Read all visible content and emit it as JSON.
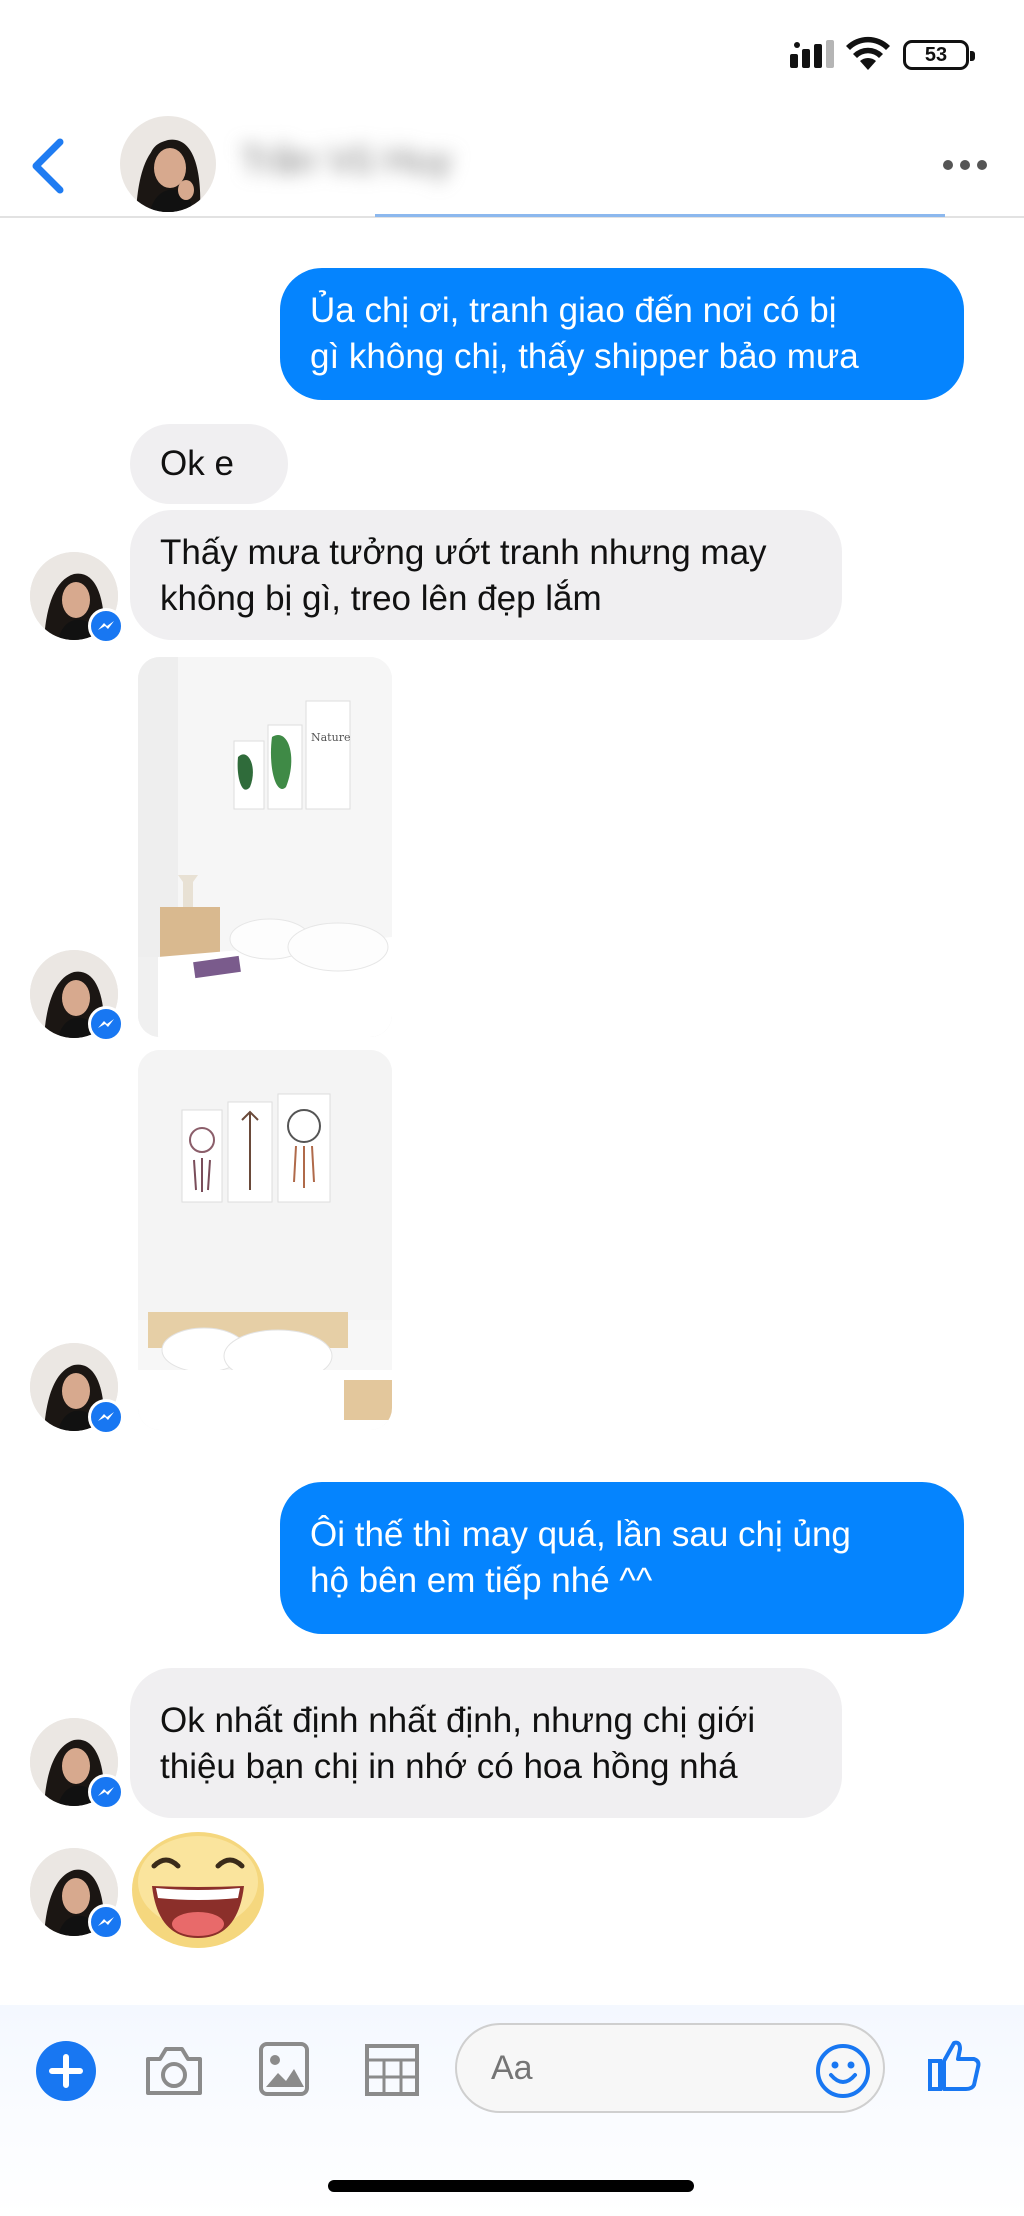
{
  "status_bar": {
    "battery_level": "53"
  },
  "header": {
    "contact_name": "Trần Vũ Huy",
    "back_icon": "chevron-left-icon",
    "more_icon": "more-dots-icon"
  },
  "messages": [
    {
      "side": "out",
      "lines": [
        "Ủa chị ơi, tranh giao đến nơi có bị",
        "gì không chị, thấy shipper bảo mưa"
      ]
    },
    {
      "side": "in",
      "lines": [
        "Ok e"
      ]
    },
    {
      "side": "in",
      "lines": [
        "Thấy mưa tưởng ướt tranh nhưng may",
        "không bị gì, treo lên đẹp lắm"
      ]
    },
    {
      "side": "in",
      "type": "photo",
      "icon": "room-photo-botanical"
    },
    {
      "side": "in",
      "type": "photo",
      "icon": "room-photo-dreamcatcher"
    },
    {
      "side": "out",
      "lines": [
        "Ôi thế thì may quá, lần sau chị ủng",
        "hộ bên em tiếp nhé ^^"
      ]
    },
    {
      "side": "in",
      "lines": [
        "Ok nhất định nhất định, nhưng chị giới",
        "thiệu bạn chị in nhớ có hoa hồng nhá"
      ]
    },
    {
      "side": "in",
      "type": "sticker",
      "icon": "laughing-emoji-sticker"
    }
  ],
  "composer": {
    "placeholder": "Aa",
    "icons": [
      "plus-icon",
      "camera-icon",
      "gallery-icon",
      "grid-icon",
      "emoji-icon",
      "thumbs-up-icon"
    ]
  },
  "colors": {
    "accent": "#0584fe",
    "incoming_bubble": "#f0eff1",
    "messenger_badge": "#1877f2"
  }
}
